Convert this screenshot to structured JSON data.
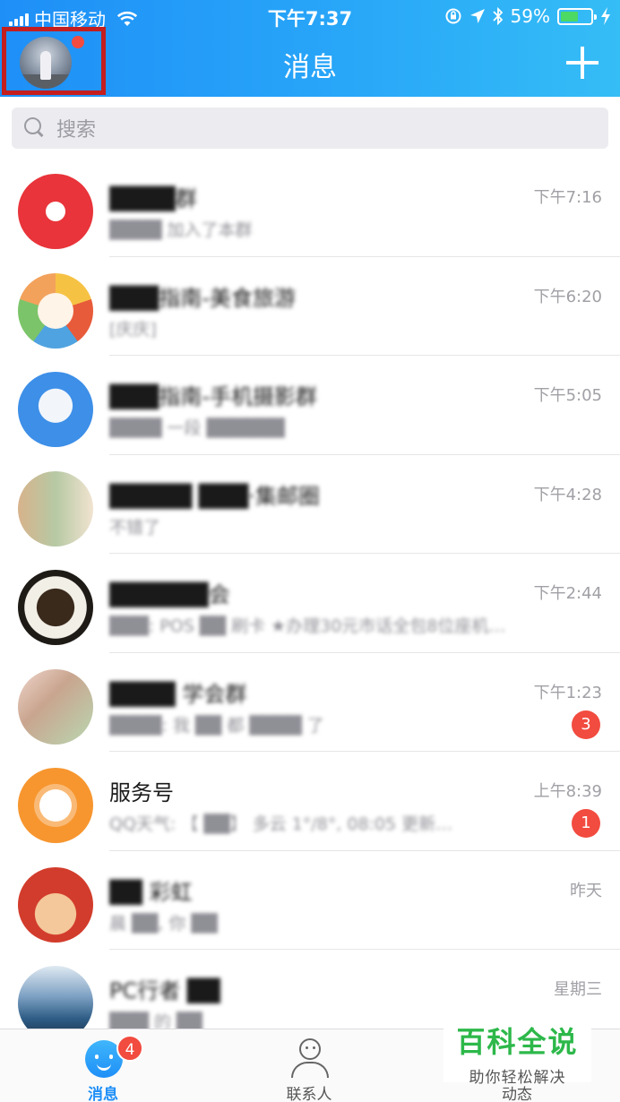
{
  "status_bar": {
    "carrier": "中国移动",
    "time": "下午7:37",
    "battery_percent": "59%",
    "battery_level": 0.59
  },
  "header": {
    "title": "消息",
    "add_icon": "plus-icon",
    "avatar_has_dot": true
  },
  "search": {
    "placeholder": "搜索"
  },
  "conversations": [
    {
      "name": "████群",
      "preview": "████ 加入了本群",
      "time": "下午7:16",
      "badge": ""
    },
    {
      "name": "███指南-美食旅游",
      "preview": "[庆庆]",
      "time": "下午6:20",
      "badge": ""
    },
    {
      "name": "███指南-手机摄影群",
      "preview": "████ 一段 ██████",
      "time": "下午5:05",
      "badge": ""
    },
    {
      "name": "█████ ███·集邮圈",
      "preview": "不错了",
      "time": "下午4:28",
      "badge": ""
    },
    {
      "name": "██████会",
      "preview": "███: POS ██ 刷卡     ★办理30元市话全包8位座机…",
      "time": "下午2:44",
      "badge": ""
    },
    {
      "name": "████ 学会群",
      "preview": "████: 我 ██ 都 ████ 了",
      "time": "下午1:23",
      "badge": "3"
    },
    {
      "name": "服务号",
      "preview": "QQ天气: 【 ██】 多云 1°/8°, 08:05 更新…",
      "time": "上午8:39",
      "badge": "1"
    },
    {
      "name": "██ 彩虹",
      "preview": "晨 ██, 你 ██",
      "time": "昨天",
      "badge": ""
    },
    {
      "name": "PC行者 ██",
      "preview": "███ 的 ██",
      "time": "星期三",
      "badge": ""
    }
  ],
  "tabbar": {
    "messages_label": "消息",
    "messages_badge": "4",
    "contacts_label": "联系人",
    "dynamic_label": "动态"
  },
  "watermark": {
    "title": "百科全说",
    "subtitle": "助你轻松解决"
  },
  "colors": {
    "header_gradient_start": "#1e8ff7",
    "header_gradient_end": "#35bdf6",
    "badge_red": "#f24b3f",
    "tab_active": "#1f8ff7"
  }
}
